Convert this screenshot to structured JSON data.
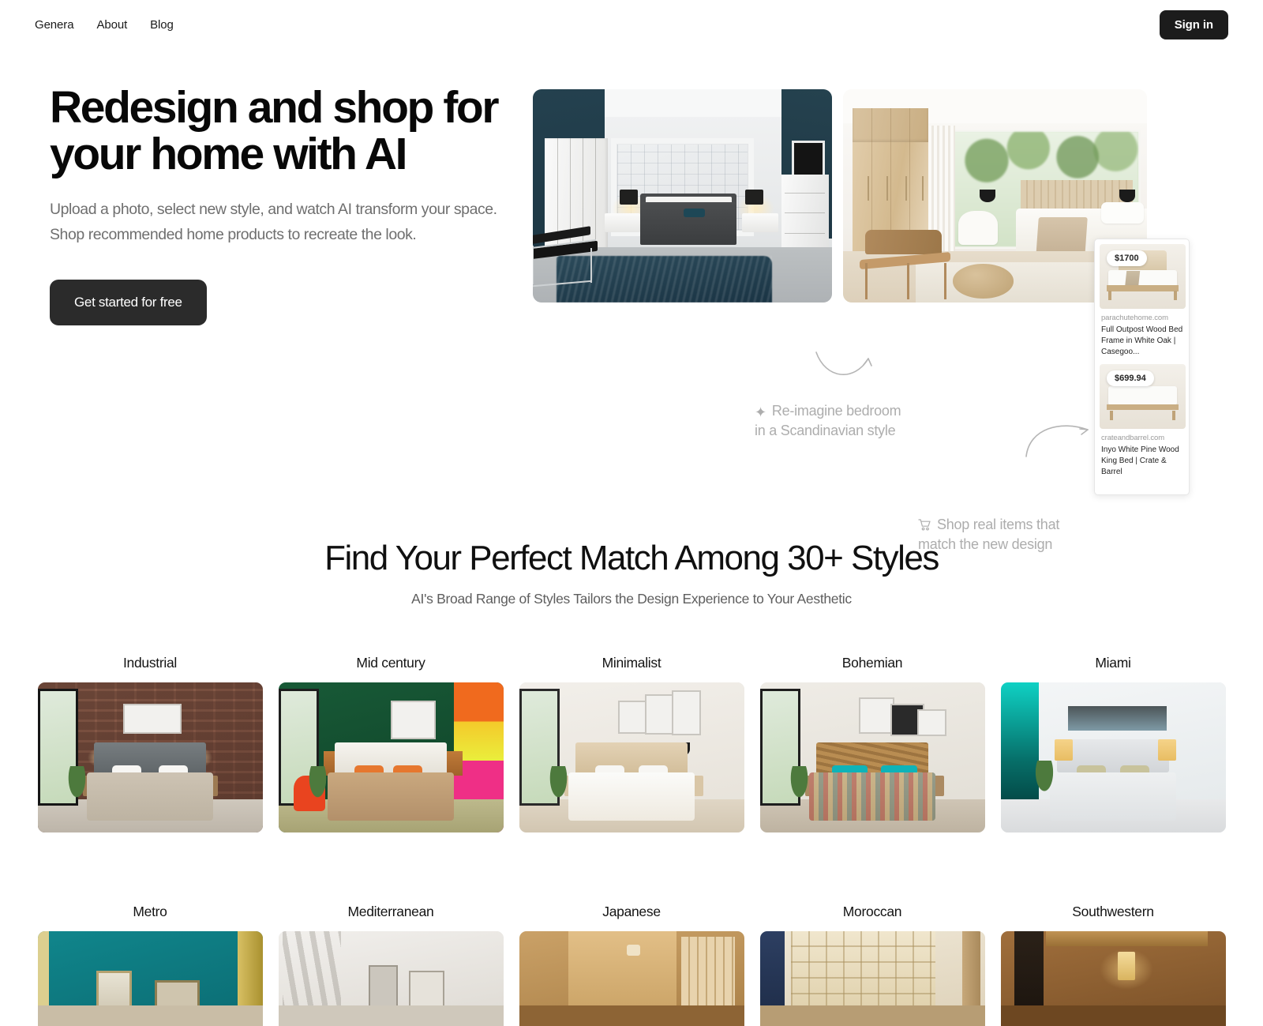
{
  "nav": {
    "links": [
      {
        "label": "Genera"
      },
      {
        "label": "About"
      },
      {
        "label": "Blog"
      }
    ],
    "signin_label": "Sign in"
  },
  "hero": {
    "title_line1": "Redesign and shop for",
    "title_line2": "your home with AI",
    "subtitle": "Upload a photo, select new style, and watch AI transform your space. Shop recommended home products to recreate the look.",
    "cta_label": "Get started for free",
    "callouts": [
      {
        "icon": "sparkle-icon",
        "glyph": "✦",
        "text": "Re-imagine bedroom\nin a Scandinavian style"
      },
      {
        "icon": "shopping-cart-icon",
        "glyph": "🛒",
        "text": "Shop real items that\nmatch the new design"
      }
    ],
    "before_image_alt": "bedroom-before-navy-modern",
    "after_image_alt": "bedroom-after-scandinavian"
  },
  "products": [
    {
      "price": "$1700",
      "domain": "parachutehome.com",
      "title": "Full Outpost Wood Bed Frame in White Oak | Casegoo..."
    },
    {
      "price": "$699.94",
      "domain": "crateandbarrel.com",
      "title": "Inyo White Pine Wood King Bed | Crate & Barrel"
    }
  ],
  "styles_section": {
    "title": "Find Your Perfect Match Among 30+ Styles",
    "subtitle": "AI's Broad Range of Styles Tailors the Design Experience to Your Aesthetic",
    "row1": [
      {
        "label": "Industrial",
        "theme": "s-ind"
      },
      {
        "label": "Mid century",
        "theme": "s-mid"
      },
      {
        "label": "Minimalist",
        "theme": "s-min"
      },
      {
        "label": "Bohemian",
        "theme": "s-boh"
      },
      {
        "label": "Miami",
        "theme": "s-mia"
      }
    ],
    "row2": [
      {
        "label": "Metro",
        "theme": "s-met"
      },
      {
        "label": "Mediterranean",
        "theme": "s-medi"
      },
      {
        "label": "Japanese",
        "theme": "s-jap"
      },
      {
        "label": "Moroccan",
        "theme": "s-mor"
      },
      {
        "label": "Southwestern",
        "theme": "s-sw"
      }
    ]
  },
  "colors": {
    "text_primary": "#101010",
    "text_muted": "#6f6f6f",
    "callout_gray": "#adadad",
    "button_dark": "#1c1c1c",
    "cta_dark": "#2b2b2b",
    "page_bg": "#ffffff"
  }
}
